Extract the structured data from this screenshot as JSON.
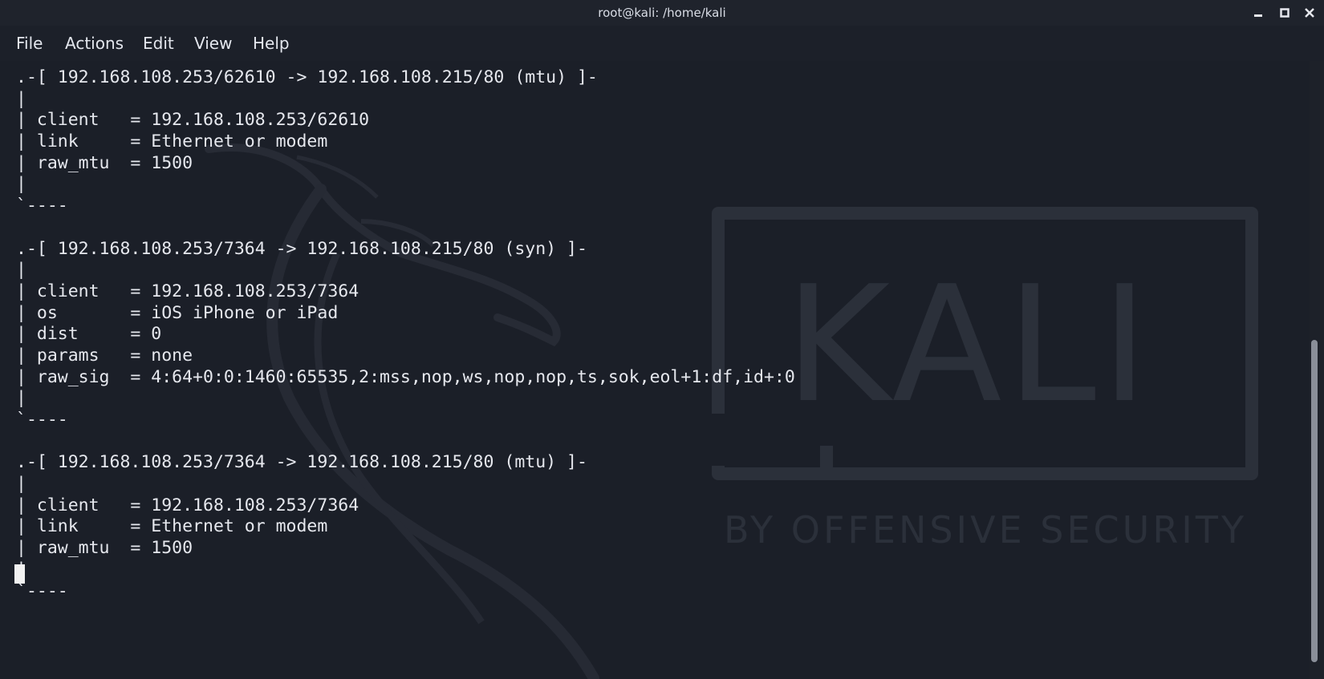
{
  "window": {
    "title": "root@kali: /home/kali"
  },
  "menu": {
    "items": [
      "File",
      "Actions",
      "Edit",
      "View",
      "Help"
    ]
  },
  "terminal": {
    "lines": [
      ".-[ 192.168.108.253/62610 -> 192.168.108.215/80 (mtu) ]-",
      "|",
      "| client   = 192.168.108.253/62610",
      "| link     = Ethernet or modem",
      "| raw_mtu  = 1500",
      "|",
      "`----",
      "",
      ".-[ 192.168.108.253/7364 -> 192.168.108.215/80 (syn) ]-",
      "|",
      "| client   = 192.168.108.253/7364",
      "| os       = iOS iPhone or iPad",
      "| dist     = 0",
      "| params   = none",
      "| raw_sig  = 4:64+0:0:1460:65535,2:mss,nop,ws,nop,nop,ts,sok,eol+1:df,id+:0",
      "|",
      "`----",
      "",
      ".-[ 192.168.108.253/7364 -> 192.168.108.215/80 (mtu) ]-",
      "|",
      "| client   = 192.168.108.253/7364",
      "| link     = Ethernet or modem",
      "| raw_mtu  = 1500",
      "|",
      "`----"
    ]
  },
  "wallpaper": {
    "logo_text": "KALI",
    "tagline": "BY OFFENSIVE SECURITY"
  },
  "colors": {
    "background": "#1b1f28",
    "text": "#e6e8ee",
    "watermark": "#2b303a"
  }
}
